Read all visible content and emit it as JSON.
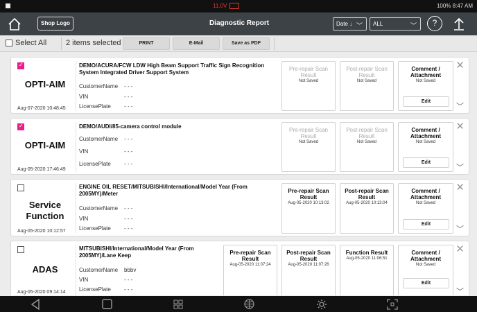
{
  "status_bar": {
    "voltage": "11.0V",
    "right_text": "100% 8:47 AM"
  },
  "header": {
    "shop_logo_label": "Shop Logo",
    "title": "Diagnostic Report",
    "date_sort_label": "Date ↓",
    "filter_label": "ALL"
  },
  "toolbar": {
    "select_all_label": "Select All",
    "selection_count": "2 items selected",
    "print_label": "PRINT",
    "email_label": "E-Mail",
    "pdf_label": "Save as PDF"
  },
  "labels": {
    "customer_name": "CustomerName",
    "vin": "VIN",
    "license_plate": "LicensePlate",
    "comment_attachment": "Comment / Attachment",
    "edit": "Edit"
  },
  "reports": [
    {
      "checked": true,
      "function": "OPTI-AIM",
      "date": "Aug-07-2020 10:48:45",
      "title": "DEMO/ACURA/FCW LDW High Beam Support Traffic Sign Recognition System Integrated Driver Support System",
      "customer_name": "- - -",
      "vin": "- - -",
      "license_plate": "- - -",
      "pre_repair": {
        "label": "Pre-repair Scan Result",
        "status": "Not Saved"
      },
      "post_repair": {
        "label": "Post-repair Scan Result",
        "status": "Not Saved"
      },
      "comment_status": "Not Saved"
    },
    {
      "checked": true,
      "function": "OPTI-AIM",
      "date": "Aug-05-2020 17:46:49",
      "title": "DEMO/AUDI/85-camera control module",
      "customer_name": "- - -",
      "vin": "- - -",
      "license_plate": "- - -",
      "pre_repair": {
        "label": "Pre-repair Scan Result",
        "status": "Not Saved"
      },
      "post_repair": {
        "label": "Post-repair Scan Result",
        "status": "Not Saved"
      },
      "comment_status": "Not Saved"
    },
    {
      "checked": false,
      "function": "Service Function",
      "date": "Aug-05-2020 10:12:57",
      "title": "ENGINE OIL RESET/MITSUBISHI/International/Model Year (From 2005MY)/Meter",
      "customer_name": "- - -",
      "vin": "- - -",
      "license_plate": "- - -",
      "pre_repair": {
        "label": "Pre-repair Scan Result",
        "status": "Aug-05-2020 10:13:02"
      },
      "post_repair": {
        "label": "Post-repair Scan Result",
        "status": "Aug-05-2020 10:13:04"
      },
      "comment_status": "Not Saved"
    },
    {
      "checked": false,
      "function": "ADAS",
      "date": "Aug-05-2020 09:14:14",
      "title": "MITSUBISHI/International/Model Year (From 2005MY)/Lane Keep",
      "customer_name": "bbbv",
      "vin": "- - -",
      "license_plate": "- - -",
      "pre_repair": {
        "label": "Pre-repair Scan Result",
        "status": "Aug-05-2020 11:07:24"
      },
      "post_repair": {
        "label": "Post-repair Scan Result",
        "status": "Aug-05-2020 11:07:26"
      },
      "function_result": {
        "label": "Function Result",
        "status": "Aug-05-2020 11:06:51"
      },
      "comment_status": "Not Saved"
    }
  ]
}
